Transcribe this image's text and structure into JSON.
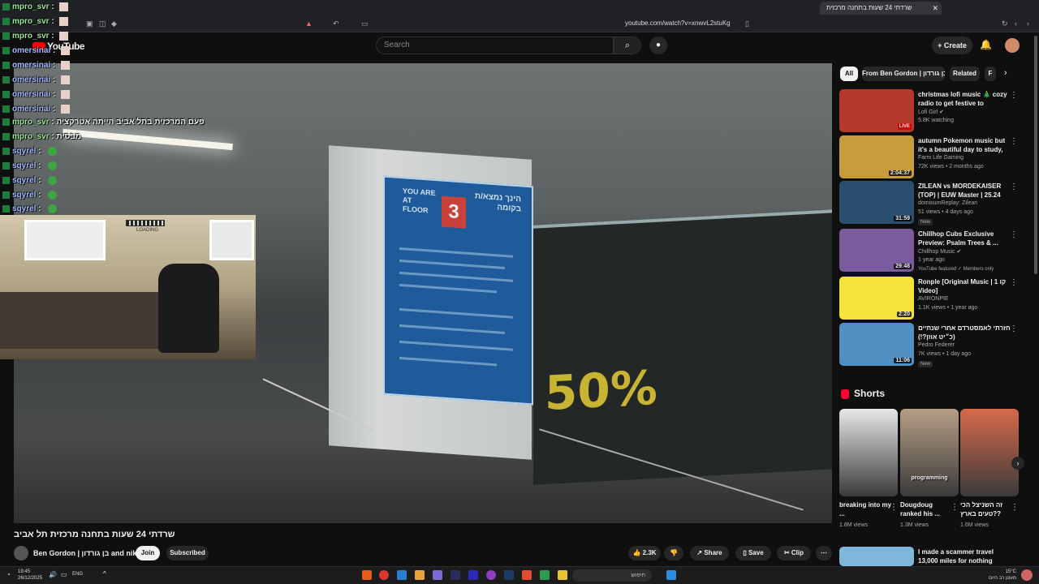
{
  "browser": {
    "tab_title": "שרדתי 24 שעות בתחנה מרכזית",
    "tab_close": "✕",
    "new_tab": "+",
    "url": "youtube.com/watch?v=xnwvL2stuKg"
  },
  "header": {
    "logo": "YouTube",
    "search_placeholder": "Search",
    "create_label": "Create"
  },
  "chat": [
    {
      "user": "mpro_svr",
      "msg": "",
      "color": "#9ee89a"
    },
    {
      "user": "mpro_svr",
      "msg": "",
      "color": "#9ee89a"
    },
    {
      "user": "mpro_svr",
      "msg": "",
      "color": "#9ee89a"
    },
    {
      "user": "omersinai",
      "msg": "",
      "color": "#a5b8ff"
    },
    {
      "user": "omersinai",
      "msg": "",
      "color": "#a5b8ff"
    },
    {
      "user": "omersinai",
      "msg": "",
      "color": "#a5b8ff"
    },
    {
      "user": "omersinai",
      "msg": "",
      "color": "#a5b8ff"
    },
    {
      "user": "omersinai",
      "msg": "",
      "color": "#a5b8ff"
    },
    {
      "user": "mpro_svr",
      "msg": "פעם המרכזית בתל אביב הייתה אטרקציה",
      "color": "#9ee89a"
    },
    {
      "user": "mpro_svr",
      "msg": "מבסית",
      "color": "#9ee89a"
    },
    {
      "user": "sqyrel",
      "msg": "",
      "color": "#a5b8ff"
    },
    {
      "user": "sqyrel",
      "msg": "",
      "color": "#a5b8ff"
    },
    {
      "user": "sqyrel",
      "msg": "",
      "color": "#a5b8ff"
    },
    {
      "user": "sqyrel",
      "msg": "",
      "color": "#a5b8ff"
    },
    {
      "user": "sqyrel",
      "msg": "",
      "color": "#a5b8ff"
    }
  ],
  "webcam": {
    "loading": "LOADING"
  },
  "video": {
    "sign_top_left": "YOU ARE AT FLOOR",
    "sign_number": "3",
    "sign_top_right": "הינך נמצא/ת בקומה",
    "shop_sale": "50%",
    "title": "שרדתי 24 שעות בתחנה מרכזית תל אביב",
    "channel": "Ben Gordon | בן גורדון and nik",
    "join": "Join",
    "subscribed": "Subscribed",
    "likes": "2.3K",
    "share": "Share",
    "save": "Save",
    "clip": "Clip"
  },
  "chips": [
    "All",
    "From Ben Gordon | בן גורדון",
    "Related",
    "F"
  ],
  "recommendations": [
    {
      "title": "christmas lofi music 🎄 cozy radio to get festive to",
      "channel": "Lofi Girl ✔",
      "meta": "5.8K watching",
      "badge": "LIVE",
      "thumb": "#b53a2e"
    },
    {
      "title": "autumn Pokemon music but it's a beautiful day to study, work, ...",
      "channel": "Farm Life Gaming",
      "meta": "72K views • 2 months ago",
      "badge": "2:04:37",
      "thumb": "#c69c3c"
    },
    {
      "title": "ZILEAN vs MORDEKAISER (TOP) | EUW Master | 25.24",
      "channel": "domisumReplay: Zilean",
      "meta": "51 views • 4 days ago",
      "badge": "31:59",
      "thumb": "#2b4f6f",
      "new": "New"
    },
    {
      "title": "Chillhop Cubs Exclusive Preview: Psalm Trees & ...",
      "channel": "Chillhop Music ✔",
      "meta": "1 year ago",
      "badge": "29:48",
      "thumb": "#7a5b9d",
      "extra": "YouTube featured  ✓ Members only"
    },
    {
      "title": "Ronple [Original Music | 1 קו Video]",
      "channel": "AVIRONPIE",
      "meta": "1.1K views • 1 year ago",
      "badge": "2:20",
      "thumb": "#f5e23a"
    },
    {
      "title": "חזרתי לאמסטרדם אחרי שנתיים (כ״יט אוזן?!)",
      "channel": "Pedro Federer",
      "meta": "7K views • 1 day ago",
      "badge": "11:06",
      "thumb": "#4f8fc1",
      "new": "New"
    }
  ],
  "shorts": {
    "heading": "Shorts",
    "items": [
      {
        "title": "breaking into my ...",
        "views": "1.8M views",
        "thumb": "#e8e8e8"
      },
      {
        "title": "Dougdoug ranked his ...",
        "views": "1.3M views",
        "thumb": "#b79f86",
        "caption": "programming"
      },
      {
        "title": "זה השניצל הכי טעים בארץ??",
        "views": "1.6M views",
        "thumb": "#d86a4a"
      }
    ],
    "next_title": "I made a scammer travel 13,000 miles for nothing"
  },
  "taskbar": {
    "time": "19:45",
    "date": "26/12/2025",
    "lang": "ENG",
    "search": "חיפוש",
    "temp": "15°C",
    "weather": "מעונן רב היום"
  }
}
